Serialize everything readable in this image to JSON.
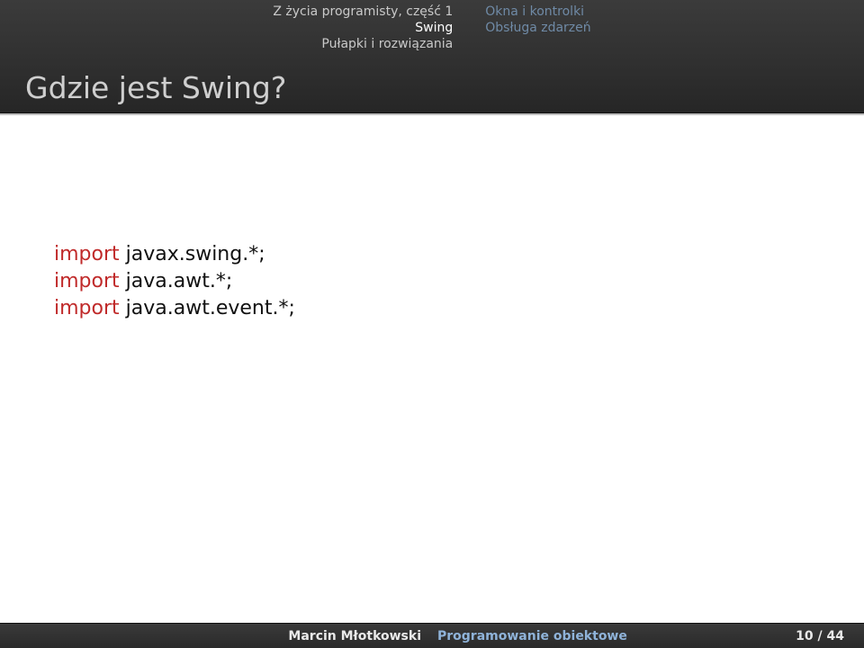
{
  "header": {
    "sections": [
      "Z życia programisty, część 1",
      "Swing",
      "Pułapki i rozwiązania"
    ],
    "current_section_index": 1,
    "subsections": [
      "Okna i kontrolki",
      "Obsługa zdarzeń"
    ],
    "current_subsection_index": -1,
    "title": "Gdzie jest Swing?"
  },
  "body": {
    "code_lines": [
      {
        "keyword": "import",
        "rest": " javax.swing.*;"
      },
      {
        "keyword": "import",
        "rest": " java.awt.*;"
      },
      {
        "keyword": "import",
        "rest": " java.awt.event.*;"
      }
    ]
  },
  "footer": {
    "author": "Marcin Młotkowski",
    "course": "Programowanie obiektowe",
    "page": "10 / 44"
  }
}
